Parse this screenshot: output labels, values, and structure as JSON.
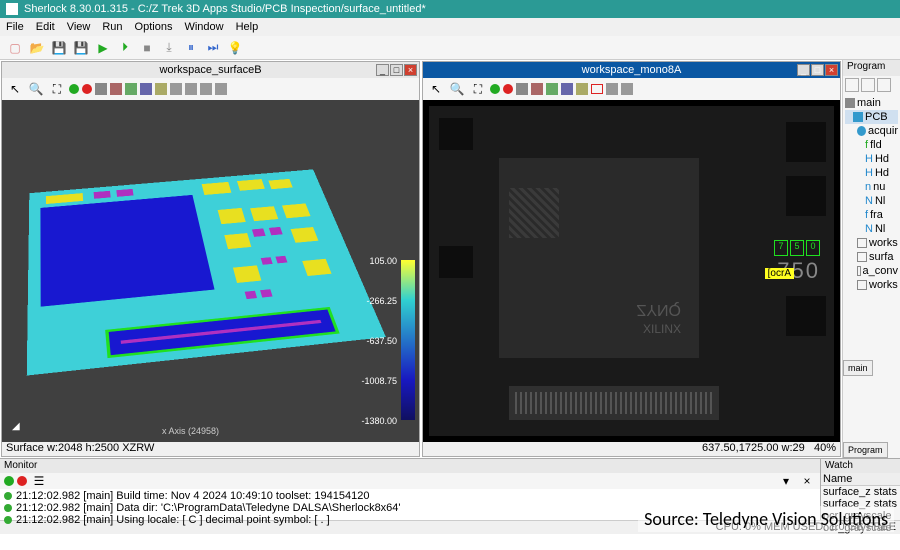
{
  "title": "Sherlock 8.30.01.315 - C:/Z Trek 3D Apps Studio/PCB Inspection/surface_untitled*",
  "menu": [
    "File",
    "Edit",
    "View",
    "Run",
    "Options",
    "Window",
    "Help"
  ],
  "workspaceA": {
    "title": "workspace_surfaceB",
    "status_left": "Surface w:2048 h:2500 XZRW",
    "legend": {
      "v0": "105.00",
      "v1": "-266.25",
      "v2": "-637.50",
      "v3": "-1008.75",
      "v4": "-1380.00"
    },
    "axis_label": "x Axis (24958)"
  },
  "workspaceB": {
    "title": "workspace_mono8A",
    "status_left": "637.50,1725.00  w:29",
    "status_right": "40%",
    "ocr_label": "[ocrA",
    "ocr_digits": [
      "7",
      "5",
      "0"
    ],
    "ocr_text": "750",
    "chip_text1": "ZYNQ",
    "chip_text2": "XILINX"
  },
  "program": {
    "header": "Program",
    "root": "main",
    "items": [
      "PCB",
      "acquir",
      "fld",
      "Hd",
      "Hd",
      "nu",
      "Nl",
      "fra",
      "Nl",
      "works",
      "surfa",
      "a_conv",
      "works"
    ]
  },
  "tabs": {
    "a": "main",
    "b": "Program"
  },
  "monitor": {
    "header": "Monitor",
    "lines": [
      "21:12:02.982 [main] Build time: Nov  4 2024 10:49:10 toolset: 194154120",
      "21:12:02.982 [main] Data dir: 'C:\\ProgramData\\Teledyne DALSA\\Sherlock8x64'",
      "21:12:02.982 [main] Using locale: [ C ] decimal point symbol: [ . ]"
    ]
  },
  "watch": {
    "header": "Watch",
    "col": "Name",
    "items": [
      "surface_z stats",
      "surface_z stats",
      "ocr_grayscale",
      "ocr_grayscale"
    ]
  },
  "statusbar": "CPU: 0% MEM USED: 1.0 GB FREE",
  "source": "Source: Teledyne Vision Solutions"
}
